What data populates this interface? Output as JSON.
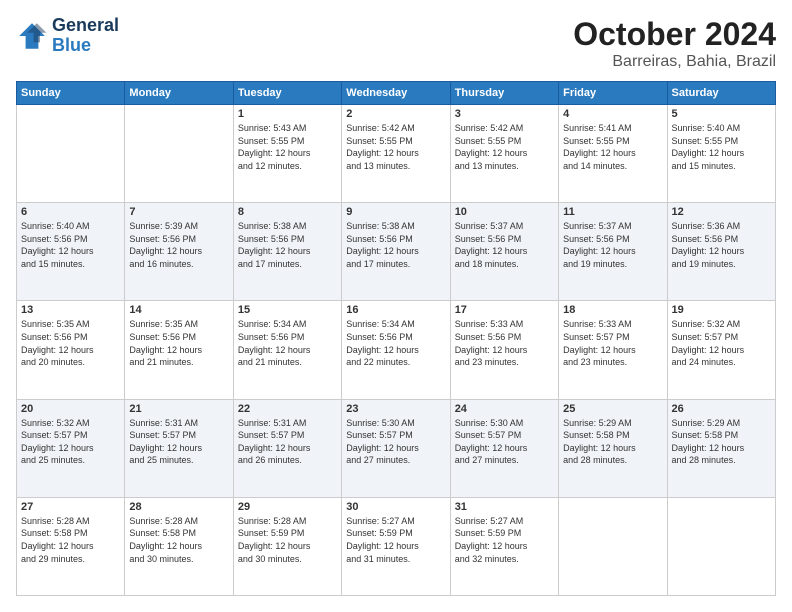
{
  "header": {
    "logo_line1": "General",
    "logo_line2": "Blue",
    "title": "October 2024",
    "subtitle": "Barreiras, Bahia, Brazil"
  },
  "days_of_week": [
    "Sunday",
    "Monday",
    "Tuesday",
    "Wednesday",
    "Thursday",
    "Friday",
    "Saturday"
  ],
  "weeks": [
    [
      {
        "num": "",
        "info": ""
      },
      {
        "num": "",
        "info": ""
      },
      {
        "num": "1",
        "info": "Sunrise: 5:43 AM\nSunset: 5:55 PM\nDaylight: 12 hours\nand 12 minutes."
      },
      {
        "num": "2",
        "info": "Sunrise: 5:42 AM\nSunset: 5:55 PM\nDaylight: 12 hours\nand 13 minutes."
      },
      {
        "num": "3",
        "info": "Sunrise: 5:42 AM\nSunset: 5:55 PM\nDaylight: 12 hours\nand 13 minutes."
      },
      {
        "num": "4",
        "info": "Sunrise: 5:41 AM\nSunset: 5:55 PM\nDaylight: 12 hours\nand 14 minutes."
      },
      {
        "num": "5",
        "info": "Sunrise: 5:40 AM\nSunset: 5:55 PM\nDaylight: 12 hours\nand 15 minutes."
      }
    ],
    [
      {
        "num": "6",
        "info": "Sunrise: 5:40 AM\nSunset: 5:56 PM\nDaylight: 12 hours\nand 15 minutes."
      },
      {
        "num": "7",
        "info": "Sunrise: 5:39 AM\nSunset: 5:56 PM\nDaylight: 12 hours\nand 16 minutes."
      },
      {
        "num": "8",
        "info": "Sunrise: 5:38 AM\nSunset: 5:56 PM\nDaylight: 12 hours\nand 17 minutes."
      },
      {
        "num": "9",
        "info": "Sunrise: 5:38 AM\nSunset: 5:56 PM\nDaylight: 12 hours\nand 17 minutes."
      },
      {
        "num": "10",
        "info": "Sunrise: 5:37 AM\nSunset: 5:56 PM\nDaylight: 12 hours\nand 18 minutes."
      },
      {
        "num": "11",
        "info": "Sunrise: 5:37 AM\nSunset: 5:56 PM\nDaylight: 12 hours\nand 19 minutes."
      },
      {
        "num": "12",
        "info": "Sunrise: 5:36 AM\nSunset: 5:56 PM\nDaylight: 12 hours\nand 19 minutes."
      }
    ],
    [
      {
        "num": "13",
        "info": "Sunrise: 5:35 AM\nSunset: 5:56 PM\nDaylight: 12 hours\nand 20 minutes."
      },
      {
        "num": "14",
        "info": "Sunrise: 5:35 AM\nSunset: 5:56 PM\nDaylight: 12 hours\nand 21 minutes."
      },
      {
        "num": "15",
        "info": "Sunrise: 5:34 AM\nSunset: 5:56 PM\nDaylight: 12 hours\nand 21 minutes."
      },
      {
        "num": "16",
        "info": "Sunrise: 5:34 AM\nSunset: 5:56 PM\nDaylight: 12 hours\nand 22 minutes."
      },
      {
        "num": "17",
        "info": "Sunrise: 5:33 AM\nSunset: 5:56 PM\nDaylight: 12 hours\nand 23 minutes."
      },
      {
        "num": "18",
        "info": "Sunrise: 5:33 AM\nSunset: 5:57 PM\nDaylight: 12 hours\nand 23 minutes."
      },
      {
        "num": "19",
        "info": "Sunrise: 5:32 AM\nSunset: 5:57 PM\nDaylight: 12 hours\nand 24 minutes."
      }
    ],
    [
      {
        "num": "20",
        "info": "Sunrise: 5:32 AM\nSunset: 5:57 PM\nDaylight: 12 hours\nand 25 minutes."
      },
      {
        "num": "21",
        "info": "Sunrise: 5:31 AM\nSunset: 5:57 PM\nDaylight: 12 hours\nand 25 minutes."
      },
      {
        "num": "22",
        "info": "Sunrise: 5:31 AM\nSunset: 5:57 PM\nDaylight: 12 hours\nand 26 minutes."
      },
      {
        "num": "23",
        "info": "Sunrise: 5:30 AM\nSunset: 5:57 PM\nDaylight: 12 hours\nand 27 minutes."
      },
      {
        "num": "24",
        "info": "Sunrise: 5:30 AM\nSunset: 5:57 PM\nDaylight: 12 hours\nand 27 minutes."
      },
      {
        "num": "25",
        "info": "Sunrise: 5:29 AM\nSunset: 5:58 PM\nDaylight: 12 hours\nand 28 minutes."
      },
      {
        "num": "26",
        "info": "Sunrise: 5:29 AM\nSunset: 5:58 PM\nDaylight: 12 hours\nand 28 minutes."
      }
    ],
    [
      {
        "num": "27",
        "info": "Sunrise: 5:28 AM\nSunset: 5:58 PM\nDaylight: 12 hours\nand 29 minutes."
      },
      {
        "num": "28",
        "info": "Sunrise: 5:28 AM\nSunset: 5:58 PM\nDaylight: 12 hours\nand 30 minutes."
      },
      {
        "num": "29",
        "info": "Sunrise: 5:28 AM\nSunset: 5:59 PM\nDaylight: 12 hours\nand 30 minutes."
      },
      {
        "num": "30",
        "info": "Sunrise: 5:27 AM\nSunset: 5:59 PM\nDaylight: 12 hours\nand 31 minutes."
      },
      {
        "num": "31",
        "info": "Sunrise: 5:27 AM\nSunset: 5:59 PM\nDaylight: 12 hours\nand 32 minutes."
      },
      {
        "num": "",
        "info": ""
      },
      {
        "num": "",
        "info": ""
      }
    ]
  ]
}
